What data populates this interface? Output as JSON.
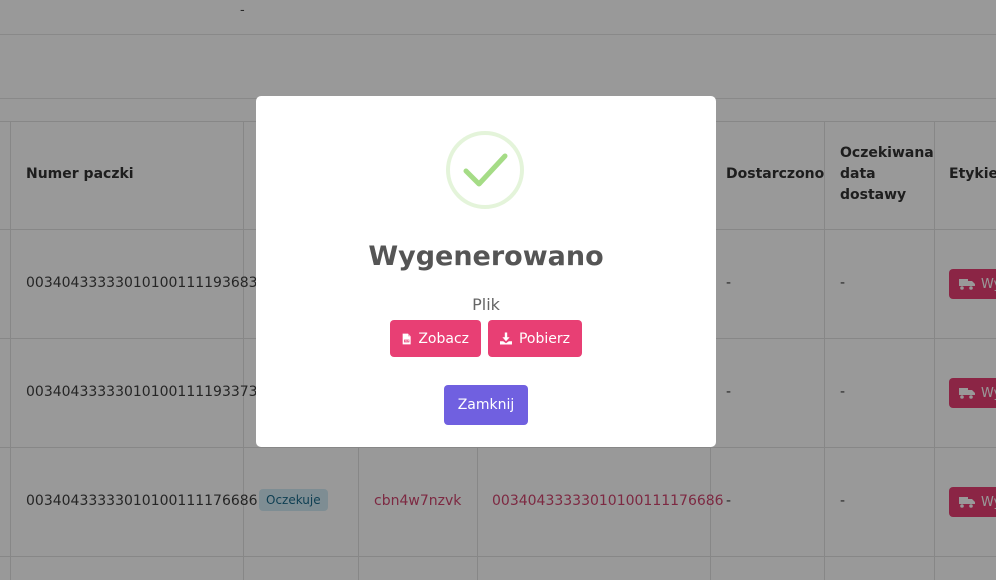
{
  "background": {
    "top_dash": "-",
    "headers": {
      "parcel_number": "Numer paczki",
      "delivered": "Dostarczono",
      "expected_line1": "Oczekiwana",
      "expected_line2": "data",
      "expected_line3": "dostawy",
      "labels": "Etykiet"
    },
    "rows": [
      {
        "parcel_number": "00340433333010100111193683",
        "delivered": "-",
        "expected": "-",
        "button_label": "Wy"
      },
      {
        "parcel_number": "00340433333010100111193373",
        "delivered": "-",
        "expected": "-",
        "button_label": "Wy"
      },
      {
        "parcel_number": "00340433333010100111176686",
        "status": "Oczekuje",
        "code": "cbn4w7nzvk",
        "tracking": "00340433333010100111176686",
        "delivered": "-",
        "expected": "-",
        "button_label": "Wy"
      }
    ]
  },
  "modal": {
    "title": "Wygenerowano",
    "subtitle": "Plik",
    "view_button": "Zobacz",
    "download_button": "Pobierz",
    "close_button": "Zamknij",
    "icons": {
      "success": "check-icon",
      "view": "pdf-file-icon",
      "download": "download-icon",
      "row": "truck-icon"
    }
  },
  "colors": {
    "accent_pink": "#e83f74",
    "close_purple": "#7060e0",
    "success_green": "#a5dc86",
    "badge_bg": "#d2ecf6",
    "link_red": "#d0456e"
  }
}
